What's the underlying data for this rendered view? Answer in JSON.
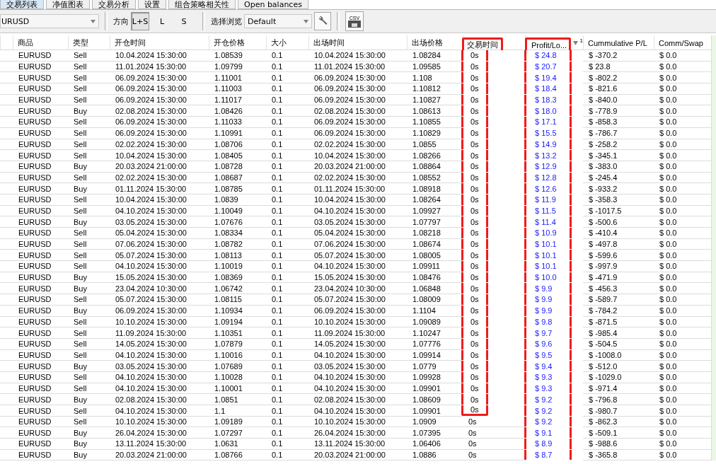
{
  "tabs": [
    {
      "label": "交易列表",
      "selected": true
    },
    {
      "label": "净值图表",
      "selected": false
    },
    {
      "label": "交易分析",
      "selected": false
    },
    {
      "label": "设置",
      "selected": false
    },
    {
      "label": "组合策略相关性",
      "selected": false
    },
    {
      "label": "Open balances",
      "selected": false
    }
  ],
  "toolbar": {
    "symbol": "URUSD",
    "direction_label": "方向",
    "directions": [
      {
        "label": "L+S",
        "selected": true
      },
      {
        "label": "L",
        "selected": false
      },
      {
        "label": "S",
        "selected": false
      }
    ],
    "view_label": "选择浏览",
    "view": "Default",
    "export_label": "CSV"
  },
  "table": {
    "columns": [
      {
        "label": "商品"
      },
      {
        "label": "类型"
      },
      {
        "label": "开仓时间"
      },
      {
        "label": "开仓价格"
      },
      {
        "label": "大小"
      },
      {
        "label": "出场时间"
      },
      {
        "label": "出场价格"
      },
      {
        "label": "交易时间",
        "framed": true,
        "frame_by_row": true
      },
      {
        "label": "Profit/Lo...",
        "framed": true,
        "sort_descending": true,
        "sort_order": "1",
        "kind": "money"
      },
      {
        "label": "Cummulative P/L"
      },
      {
        "label": "Comm/Swap"
      }
    ],
    "rows": [
      {
        "cells": [
          "EURUSD",
          "Sell",
          "10.04.2024 15:30:00",
          "1.08539",
          "0.1",
          "10.04.2024 15:30:00",
          "1.08284",
          "0s",
          "$ 24.8",
          "$ -370.2",
          "$ 0.0"
        ],
        "framed": true
      },
      {
        "cells": [
          "EURUSD",
          "Sell",
          "11.01.2024 15:30:00",
          "1.09799",
          "0.1",
          "11.01.2024 15:30:00",
          "1.09585",
          "0s",
          "$ 20.7",
          "$ 23.8",
          "$ 0.0"
        ],
        "framed": true
      },
      {
        "cells": [
          "EURUSD",
          "Sell",
          "06.09.2024 15:30:00",
          "1.11001",
          "0.1",
          "06.09.2024 15:30:00",
          "1.108",
          "0s",
          "$ 19.4",
          "$ -802.2",
          "$ 0.0"
        ],
        "framed": true
      },
      {
        "cells": [
          "EURUSD",
          "Sell",
          "06.09.2024 15:30:00",
          "1.11003",
          "0.1",
          "06.09.2024 15:30:00",
          "1.10812",
          "0s",
          "$ 18.4",
          "$ -821.6",
          "$ 0.0"
        ],
        "framed": true
      },
      {
        "cells": [
          "EURUSD",
          "Sell",
          "06.09.2024 15:30:00",
          "1.11017",
          "0.1",
          "06.09.2024 15:30:00",
          "1.10827",
          "0s",
          "$ 18.3",
          "$ -840.0",
          "$ 0.0"
        ],
        "framed": true
      },
      {
        "cells": [
          "EURUSD",
          "Buy",
          "02.08.2024 15:30:00",
          "1.08426",
          "0.1",
          "02.08.2024 15:30:00",
          "1.08613",
          "0s",
          "$ 18.0",
          "$ -778.9",
          "$ 0.0"
        ],
        "framed": true
      },
      {
        "cells": [
          "EURUSD",
          "Sell",
          "06.09.2024 15:30:00",
          "1.11033",
          "0.1",
          "06.09.2024 15:30:00",
          "1.10855",
          "0s",
          "$ 17.1",
          "$ -858.3",
          "$ 0.0"
        ],
        "framed": true
      },
      {
        "cells": [
          "EURUSD",
          "Sell",
          "06.09.2024 15:30:00",
          "1.10991",
          "0.1",
          "06.09.2024 15:30:00",
          "1.10829",
          "0s",
          "$ 15.5",
          "$ -786.7",
          "$ 0.0"
        ],
        "framed": true
      },
      {
        "cells": [
          "EURUSD",
          "Sell",
          "02.02.2024 15:30:00",
          "1.08706",
          "0.1",
          "02.02.2024 15:30:00",
          "1.0855",
          "0s",
          "$ 14.9",
          "$ -258.2",
          "$ 0.0"
        ],
        "framed": true
      },
      {
        "cells": [
          "EURUSD",
          "Sell",
          "10.04.2024 15:30:00",
          "1.08405",
          "0.1",
          "10.04.2024 15:30:00",
          "1.08266",
          "0s",
          "$ 13.2",
          "$ -345.1",
          "$ 0.0"
        ],
        "framed": true
      },
      {
        "cells": [
          "EURUSD",
          "Buy",
          "20.03.2024 21:00:00",
          "1.08728",
          "0.1",
          "20.03.2024 21:00:00",
          "1.08864",
          "0s",
          "$ 12.9",
          "$ -383.0",
          "$ 0.0"
        ],
        "framed": true
      },
      {
        "cells": [
          "EURUSD",
          "Sell",
          "02.02.2024 15:30:00",
          "1.08687",
          "0.1",
          "02.02.2024 15:30:00",
          "1.08552",
          "0s",
          "$ 12.8",
          "$ -245.4",
          "$ 0.0"
        ],
        "framed": true
      },
      {
        "cells": [
          "EURUSD",
          "Buy",
          "01.11.2024 15:30:00",
          "1.08785",
          "0.1",
          "01.11.2024 15:30:00",
          "1.08918",
          "0s",
          "$ 12.6",
          "$ -933.2",
          "$ 0.0"
        ],
        "framed": true
      },
      {
        "cells": [
          "EURUSD",
          "Sell",
          "10.04.2024 15:30:00",
          "1.0839",
          "0.1",
          "10.04.2024 15:30:00",
          "1.08264",
          "0s",
          "$ 11.9",
          "$ -358.3",
          "$ 0.0"
        ],
        "framed": true
      },
      {
        "cells": [
          "EURUSD",
          "Sell",
          "04.10.2024 15:30:00",
          "1.10049",
          "0.1",
          "04.10.2024 15:30:00",
          "1.09927",
          "0s",
          "$ 11.5",
          "$ -1017.5",
          "$ 0.0"
        ],
        "framed": true
      },
      {
        "cells": [
          "EURUSD",
          "Buy",
          "03.05.2024 15:30:00",
          "1.07676",
          "0.1",
          "03.05.2024 15:30:00",
          "1.07797",
          "0s",
          "$ 11.4",
          "$ -500.6",
          "$ 0.0"
        ],
        "framed": true
      },
      {
        "cells": [
          "EURUSD",
          "Sell",
          "05.04.2024 15:30:00",
          "1.08334",
          "0.1",
          "05.04.2024 15:30:00",
          "1.08218",
          "0s",
          "$ 10.9",
          "$ -410.4",
          "$ 0.0"
        ],
        "framed": true
      },
      {
        "cells": [
          "EURUSD",
          "Sell",
          "07.06.2024 15:30:00",
          "1.08782",
          "0.1",
          "07.06.2024 15:30:00",
          "1.08674",
          "0s",
          "$ 10.1",
          "$ -497.8",
          "$ 0.0"
        ],
        "framed": true
      },
      {
        "cells": [
          "EURUSD",
          "Sell",
          "05.07.2024 15:30:00",
          "1.08113",
          "0.1",
          "05.07.2024 15:30:00",
          "1.08005",
          "0s",
          "$ 10.1",
          "$ -599.6",
          "$ 0.0"
        ],
        "framed": true
      },
      {
        "cells": [
          "EURUSD",
          "Sell",
          "04.10.2024 15:30:00",
          "1.10019",
          "0.1",
          "04.10.2024 15:30:00",
          "1.09911",
          "0s",
          "$ 10.1",
          "$ -997.9",
          "$ 0.0"
        ],
        "framed": true
      },
      {
        "cells": [
          "EURUSD",
          "Buy",
          "15.05.2024 15:30:00",
          "1.08369",
          "0.1",
          "15.05.2024 15:30:00",
          "1.08476",
          "0s",
          "$ 10.0",
          "$ -471.9",
          "$ 0.0"
        ],
        "framed": true
      },
      {
        "cells": [
          "EURUSD",
          "Buy",
          "23.04.2024 10:30:00",
          "1.06742",
          "0.1",
          "23.04.2024 10:30:00",
          "1.06848",
          "0s",
          "$ 9.9",
          "$ -456.3",
          "$ 0.0"
        ],
        "framed": true
      },
      {
        "cells": [
          "EURUSD",
          "Sell",
          "05.07.2024 15:30:00",
          "1.08115",
          "0.1",
          "05.07.2024 15:30:00",
          "1.08009",
          "0s",
          "$ 9.9",
          "$ -589.7",
          "$ 0.0"
        ],
        "framed": true
      },
      {
        "cells": [
          "EURUSD",
          "Buy",
          "06.09.2024 15:30:00",
          "1.10934",
          "0.1",
          "06.09.2024 15:30:00",
          "1.1104",
          "0s",
          "$ 9.9",
          "$ -784.2",
          "$ 0.0"
        ],
        "framed": true
      },
      {
        "cells": [
          "EURUSD",
          "Sell",
          "10.10.2024 15:30:00",
          "1.09194",
          "0.1",
          "10.10.2024 15:30:00",
          "1.09089",
          "0s",
          "$ 9.8",
          "$ -871.5",
          "$ 0.0"
        ],
        "framed": true
      },
      {
        "cells": [
          "EURUSD",
          "Sell",
          "11.09.2024 15:30:00",
          "1.10351",
          "0.1",
          "11.09.2024 15:30:00",
          "1.10247",
          "0s",
          "$ 9.7",
          "$ -985.4",
          "$ 0.0"
        ],
        "framed": true
      },
      {
        "cells": [
          "EURUSD",
          "Sell",
          "14.05.2024 15:30:00",
          "1.07879",
          "0.1",
          "14.05.2024 15:30:00",
          "1.07776",
          "0s",
          "$ 9.6",
          "$ -504.5",
          "$ 0.0"
        ],
        "framed": true
      },
      {
        "cells": [
          "EURUSD",
          "Sell",
          "04.10.2024 15:30:00",
          "1.10016",
          "0.1",
          "04.10.2024 15:30:00",
          "1.09914",
          "0s",
          "$ 9.5",
          "$ -1008.0",
          "$ 0.0"
        ],
        "framed": true
      },
      {
        "cells": [
          "EURUSD",
          "Buy",
          "03.05.2024 15:30:00",
          "1.07689",
          "0.1",
          "03.05.2024 15:30:00",
          "1.0779",
          "0s",
          "$ 9.4",
          "$ -512.0",
          "$ 0.0"
        ],
        "framed": true
      },
      {
        "cells": [
          "EURUSD",
          "Sell",
          "04.10.2024 15:30:00",
          "1.10028",
          "0.1",
          "04.10.2024 15:30:00",
          "1.09928",
          "0s",
          "$ 9.3",
          "$ -1029.0",
          "$ 0.0"
        ],
        "framed": true
      },
      {
        "cells": [
          "EURUSD",
          "Sell",
          "04.10.2024 15:30:00",
          "1.10001",
          "0.1",
          "04.10.2024 15:30:00",
          "1.09901",
          "0s",
          "$ 9.3",
          "$ -971.4",
          "$ 0.0"
        ],
        "framed": true
      },
      {
        "cells": [
          "EURUSD",
          "Buy",
          "02.08.2024 15:30:00",
          "1.0851",
          "0.1",
          "02.08.2024 15:30:00",
          "1.08609",
          "0s",
          "$ 9.2",
          "$ -796.8",
          "$ 0.0"
        ],
        "framed": true
      },
      {
        "cells": [
          "EURUSD",
          "Sell",
          "04.10.2024 15:30:00",
          "1.1",
          "0.1",
          "04.10.2024 15:30:00",
          "1.09901",
          "0s",
          "$ 9.2",
          "$ -980.7",
          "$ 0.0"
        ],
        "framed": true
      },
      {
        "cells": [
          "EURUSD",
          "Sell",
          "10.10.2024 15:30:00",
          "1.09189",
          "0.1",
          "10.10.2024 15:30:00",
          "1.0909",
          "0s",
          "$ 9.2",
          "$ -862.3",
          "$ 0.0"
        ],
        "framed": false
      },
      {
        "cells": [
          "EURUSD",
          "Buy",
          "26.04.2024 15:30:00",
          "1.07297",
          "0.1",
          "26.04.2024 15:30:00",
          "1.07395",
          "0s",
          "$ 9.1",
          "$ -509.1",
          "$ 0.0"
        ],
        "framed": false
      },
      {
        "cells": [
          "EURUSD",
          "Buy",
          "13.11.2024 15:30:00",
          "1.0631",
          "0.1",
          "13.11.2024 15:30:00",
          "1.06406",
          "0s",
          "$ 8.9",
          "$ -988.6",
          "$ 0.0"
        ],
        "framed": false
      },
      {
        "cells": [
          "EURUSD",
          "Buy",
          "20.03.2024 21:00:00",
          "1.08766",
          "0.1",
          "20.03.2024 21:00:00",
          "1.0886",
          "0s",
          "$ 8.7",
          "$ -365.8",
          "$ 0.0"
        ],
        "framed": false
      }
    ]
  }
}
